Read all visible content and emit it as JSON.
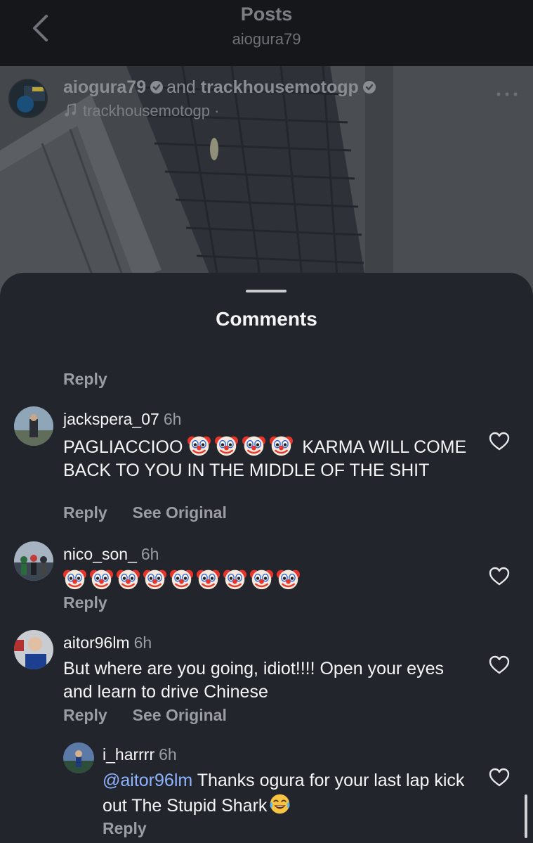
{
  "nav": {
    "title": "Posts",
    "subtitle": "aiogura79"
  },
  "post": {
    "author_1": "aiogura79",
    "author_join": "and",
    "author_2": "trackhousemotogp",
    "audio_label": "trackhousemotogp ·"
  },
  "sheet": {
    "title": "Comments",
    "previous_reply": "Reply"
  },
  "comments": [
    {
      "username": "jackspera_07",
      "time": "6h",
      "text_before": "PAGLIACCIOO",
      "emoji_count": 4,
      "text_after": " KARMA WILL COME BACK TO YOU IN THE MIDDLE OF THE SHIT",
      "reply": "Reply",
      "see_original": "See Original"
    },
    {
      "username": "nico_son_",
      "time": "6h",
      "emoji_count": 9,
      "reply": "Reply"
    },
    {
      "username": "aitor96lm",
      "time": "6h",
      "text": "But where are you going, idiot!!!! Open your eyes and learn to drive Chinese",
      "reply": "Reply",
      "see_original": "See Original"
    },
    {
      "username": "i_harrrr",
      "time": "6h",
      "mention": "@aitor96lm",
      "text": " Thanks ogura for your last lap kick out The Stupid Shark",
      "reply": "Reply"
    }
  ],
  "icons": {
    "back": "chevron-left-icon",
    "verified": "verified-badge-icon",
    "music": "music-note-icon",
    "more": "more-dots-icon",
    "like": "heart-outline-icon",
    "clown": "clown-face-emoji",
    "laugh": "tears-of-joy-emoji"
  },
  "colors": {
    "sheet_bg": "#22252b",
    "text_primary": "#f4f5f7",
    "text_secondary": "#9a9da3",
    "mention": "#8fb3ff"
  }
}
